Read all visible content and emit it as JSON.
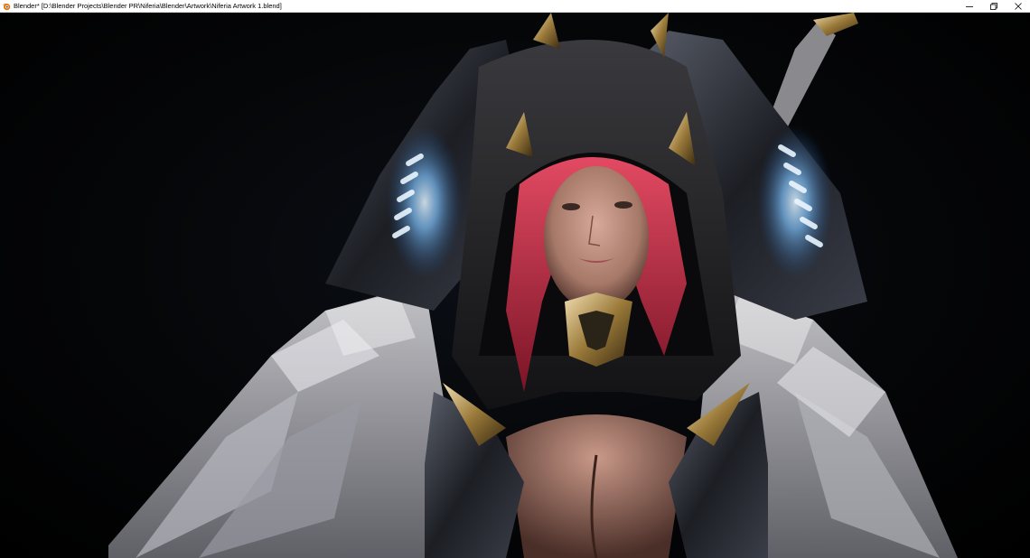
{
  "window": {
    "title": "Blender* [D:\\Blender Projects\\Blender PR\\Niferia\\Blender\\Artwork\\Niferia Artwork 1.blend]",
    "app_icon": "blender-logo-icon",
    "controls": {
      "minimize_icon": "minimize-icon",
      "restore_icon": "restore-icon",
      "close_icon": "close-icon"
    }
  },
  "viewport": {
    "content": "render-preview",
    "background_color": "#000000"
  }
}
